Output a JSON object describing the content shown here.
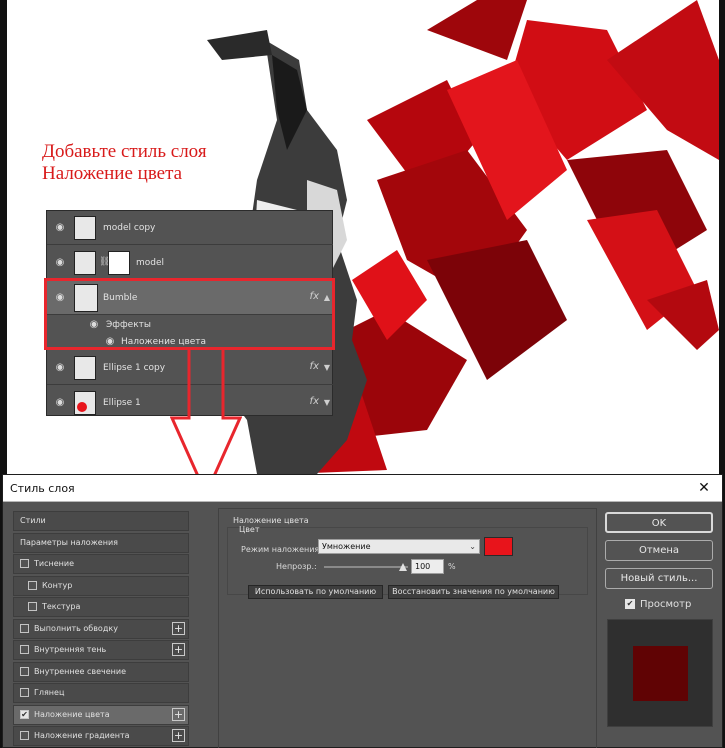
{
  "artwork": {
    "instruction": "Добавьте стиль слоя\nНаложение цвета"
  },
  "layers_panel": {
    "layers": [
      {
        "name": "model copy",
        "visible": true
      },
      {
        "name": "model",
        "visible": true
      },
      {
        "name": "Bumble",
        "visible": true,
        "fx": "fx",
        "expanded": true
      },
      {
        "name": "Ellipse 1 copy",
        "visible": true,
        "fx": "fx"
      },
      {
        "name": "Ellipse 1",
        "visible": true,
        "fx": "fx"
      }
    ],
    "effects_label": "Эффекты",
    "effect_item": "Наложение цвета",
    "fx_label": "fx"
  },
  "dialog": {
    "title": "Стиль слоя",
    "close_glyph": "✕",
    "styles_list": [
      {
        "label": "Стили",
        "checkbox": false,
        "checked": false,
        "plus": false
      },
      {
        "label": "Параметры наложения",
        "checkbox": false,
        "checked": false,
        "plus": false
      },
      {
        "label": "Тиснение",
        "checkbox": true,
        "checked": false,
        "plus": false
      },
      {
        "label": "Контур",
        "checkbox": true,
        "checked": false,
        "plus": false,
        "indent": true
      },
      {
        "label": "Текстура",
        "checkbox": true,
        "checked": false,
        "plus": false,
        "indent": true
      },
      {
        "label": "Выполнить обводку",
        "checkbox": true,
        "checked": false,
        "plus": true
      },
      {
        "label": "Внутренняя тень",
        "checkbox": true,
        "checked": false,
        "plus": true
      },
      {
        "label": "Внутреннее свечение",
        "checkbox": true,
        "checked": false,
        "plus": false
      },
      {
        "label": "Глянец",
        "checkbox": true,
        "checked": false,
        "plus": false
      },
      {
        "label": "Наложение цвета",
        "checkbox": true,
        "checked": true,
        "plus": true,
        "selected": true
      },
      {
        "label": "Наложение градиента",
        "checkbox": true,
        "checked": false,
        "plus": true
      }
    ],
    "color_overlay": {
      "group_title": "Наложение цвета",
      "sub_title": "Цвет",
      "blend_mode_label": "Режим наложения:",
      "blend_mode_value": "Умножение",
      "color": "#e8141b",
      "opacity_label": "Непрозр.:",
      "opacity_value": "100",
      "opacity_unit": "%",
      "make_default": "Использовать по умолчанию",
      "reset_default": "Восстановить значения по умолчанию"
    },
    "buttons": {
      "ok": "OK",
      "cancel": "Отмена",
      "new_style": "Новый стиль..."
    },
    "preview": {
      "label": "Просмотр",
      "checked": true,
      "swatch_color": "#600304"
    }
  }
}
